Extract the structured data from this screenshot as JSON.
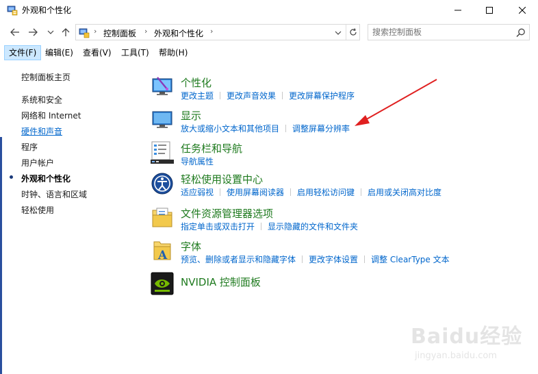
{
  "window": {
    "title": "外观和个性化"
  },
  "navigation": {
    "breadcrumb": [
      "控制面板",
      "外观和个性化"
    ],
    "search_placeholder": "搜索控制面板"
  },
  "menubar": {
    "items": [
      "文件(F)",
      "编辑(E)",
      "查看(V)",
      "工具(T)",
      "帮助(H)"
    ],
    "active_index": 0
  },
  "sidebar": {
    "items": [
      {
        "label": "控制面板主页"
      },
      {
        "label": "系统和安全"
      },
      {
        "label": "网络和 Internet"
      },
      {
        "label": "硬件和声音"
      },
      {
        "label": "程序"
      },
      {
        "label": "用户帐户"
      },
      {
        "label": "外观和个性化",
        "current": true
      },
      {
        "label": "时钟、语言和区域"
      },
      {
        "label": "轻松使用"
      }
    ]
  },
  "categories": [
    {
      "title": "个性化",
      "icon": "personalization-icon",
      "links": [
        "更改主题",
        "更改声音效果",
        "更改屏幕保护程序"
      ]
    },
    {
      "title": "显示",
      "icon": "display-icon",
      "links": [
        "放大或缩小文本和其他项目",
        "调整屏幕分辨率"
      ]
    },
    {
      "title": "任务栏和导航",
      "icon": "taskbar-icon",
      "links": [
        "导航属性"
      ]
    },
    {
      "title": "轻松使用设置中心",
      "icon": "ease-of-access-icon",
      "links": [
        "适应弱视",
        "使用屏幕阅读器",
        "启用轻松访问键",
        "启用或关闭高对比度"
      ]
    },
    {
      "title": "文件资源管理器选项",
      "icon": "folder-options-icon",
      "links": [
        "指定单击或双击打开",
        "显示隐藏的文件和文件夹"
      ]
    },
    {
      "title": "字体",
      "icon": "fonts-icon",
      "links": [
        "预览、删除或者显示和隐藏字体",
        "更改字体设置",
        "调整 ClearType 文本"
      ]
    },
    {
      "title": "NVIDIA 控制面板",
      "icon": "nvidia-icon",
      "links": []
    }
  ],
  "watermark": {
    "brand": "Baidu经验",
    "url": "jingyan.baidu.com"
  },
  "colors": {
    "category_title": "#1e7a1e",
    "link": "#0066cc",
    "annotation_arrow": "#e02020"
  }
}
